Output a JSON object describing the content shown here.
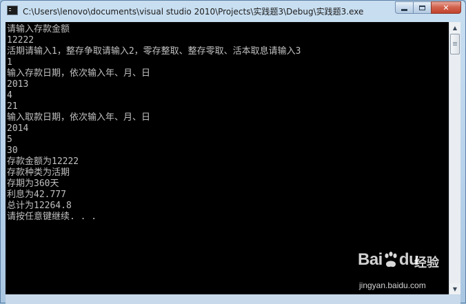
{
  "window": {
    "title": "C:\\Users\\lenovo\\documents\\visual studio 2010\\Projects\\实践题3\\Debug\\实践题3.exe"
  },
  "console": {
    "lines": [
      "请输入存款金额",
      "12222",
      "活期请输入1，整存争取请输入2，零存整取、整存零取、活本取息请输入3",
      "1",
      "输入存款日期，依次输入年、月、日",
      "2013",
      "4",
      "21",
      "输入取款日期，依次输入年、月、日",
      "2014",
      "5",
      "30",
      "存款金额为12222",
      "存款种类为活期",
      "存期为360天",
      "利息为42.777",
      "总计为12264.8",
      "请按任意键继续. . ."
    ]
  },
  "watermark": {
    "brand_left": "Bai",
    "brand_right": "du",
    "product": "经验",
    "url": "jingyan.baidu.com"
  },
  "colors": {
    "console_bg": "#000000",
    "console_text": "#c0c0c0",
    "titlebar": "#b7d1ea"
  }
}
